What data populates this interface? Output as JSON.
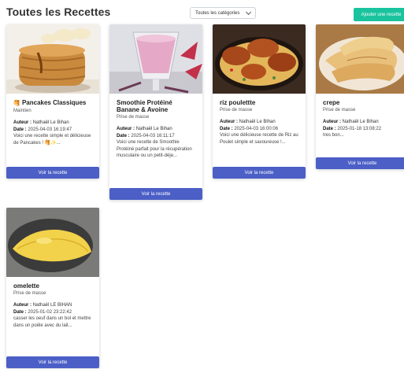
{
  "header": {
    "title": "Toutes les Recettes",
    "category_select": "Toutes les catégories",
    "add_button": "Ajouter une recette"
  },
  "labels": {
    "author": "Auteur :",
    "date": "Date :",
    "view_button": "Voir la recette"
  },
  "recipes": [
    {
      "title": "Pancakes Classiques",
      "title_icon": "pancake-emoji",
      "category": "Maintien",
      "author": "Nathaël Le Bihan",
      "date": "2025-04-03 16:19:47",
      "description": "Voici une recette simple et délicieuse de Pancakes ! 🥞✨..."
    },
    {
      "title": "Smoothie Protéiné Banane & Avoine",
      "category": "Prise de masse",
      "author": "Nathaël Le Bihan",
      "date": "2025-04-03 16:11:17",
      "description": "Voici une recette de Smoothie Protéiné parfait pour la récupération musculaire ou un petit-déje..."
    },
    {
      "title": "riz poulettte",
      "category": "Prise de masse",
      "author": "Nathaël Le Bihan",
      "date": "2025-04-03 16:00:06",
      "description": "Voici une délicieuse recette de Riz au Poulet simple et savoureuse !..."
    },
    {
      "title": "crepe",
      "category": "Prise de masse",
      "author": "Nathaël Le Bihan",
      "date": "2025-01-18 13:08:22",
      "description": "tres bon..."
    },
    {
      "title": "omelette",
      "category": "Prise de masse",
      "author": "Nathaël LE BIHAN",
      "date": "2025-01-02 23:22:42",
      "description": "casser les oeuf dans un bol et mettre dans un poële avec du lait..."
    }
  ]
}
